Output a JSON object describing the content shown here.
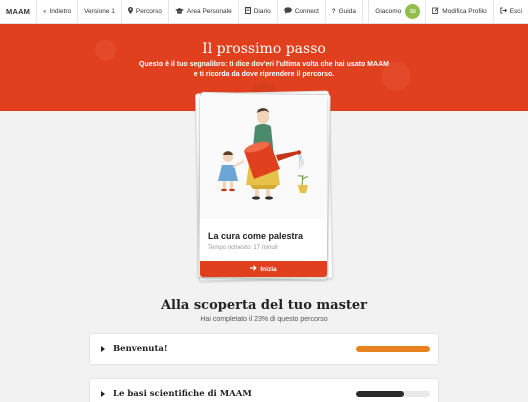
{
  "nav": {
    "brand": "MAAM",
    "items": [
      {
        "icon": "double-left-chevron-icon",
        "glyph": "«",
        "label": "Indietro"
      },
      {
        "icon": "",
        "glyph": "",
        "label": "Versione 1"
      },
      {
        "icon": "map-marker-icon",
        "glyph": "⚲",
        "label": "Percorso"
      },
      {
        "icon": "graduation-cap-icon",
        "glyph": "🎓",
        "label": "Area Personale"
      },
      {
        "icon": "book-icon",
        "glyph": "▤",
        "label": "Diario"
      },
      {
        "icon": "speech-bubble-icon",
        "glyph": "💬",
        "label": "Connect"
      },
      {
        "icon": "question-icon",
        "glyph": "?",
        "label": "Guida"
      }
    ],
    "user_name": "Giacomo",
    "user_initials": "GI",
    "edit_profile": "Modifica Profilo",
    "logout": "Esci"
  },
  "hero": {
    "title": "Il prossimo passo",
    "subtitle_line1": "Questo è il tuo segnalibro: ti dice dov'eri l'ultima volta che hai usato MAAM",
    "subtitle_line2": "e ti ricorda da dove riprendere il percorso.",
    "bg_color": "#e0401e"
  },
  "next_card": {
    "title": "La cura come palestra",
    "time_label": "Tempo richiesto: 17 minuti",
    "button_label": "Inizia",
    "button_icon": "arrow-right-icon"
  },
  "progress_section": {
    "title": "Alla scoperta del tuo master",
    "subtitle": "Hai completato il 23% di questo percorso"
  },
  "modules": [
    {
      "title": "Benvenuta!",
      "progress": 1.0,
      "bar_color": "#e8821e"
    },
    {
      "title": "Le basi scientifiche di MAAM",
      "progress": 0.65,
      "bar_color": "#2b2b2b"
    }
  ]
}
